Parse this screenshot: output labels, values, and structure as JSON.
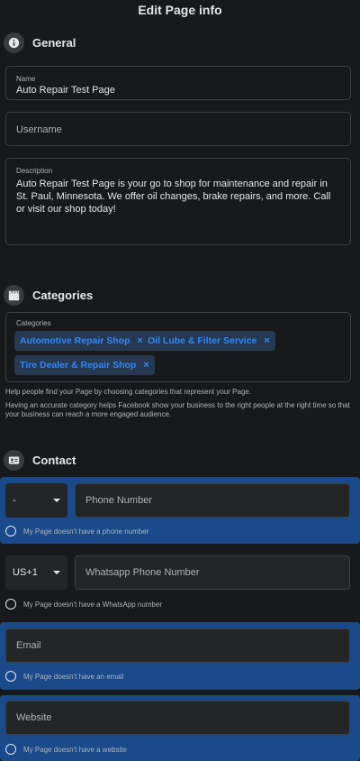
{
  "header": {
    "title": "Edit Page info"
  },
  "general": {
    "heading": "General",
    "icon": "info-icon",
    "name": {
      "label": "Name",
      "value": "Auto Repair Test Page"
    },
    "username": {
      "placeholder": "Username"
    },
    "description": {
      "label": "Description",
      "value": "Auto Repair Test Page is your go to shop for maintenance and repair in St. Paul, Minnesota. We offer oil changes, brake repairs, and more. Call or visit our shop today!"
    }
  },
  "categories": {
    "heading": "Categories",
    "icon": "clapperboard-icon",
    "label": "Categories",
    "chips": [
      "Automotive Repair Shop",
      "Oil Lube & Filter Service",
      "Tire Dealer & Repair Shop"
    ],
    "remove_glyph": "×",
    "help1": "Help people find your Page by choosing categories that represent your Page.",
    "help2": "Having an accurate category helps Facebook show your business to the right people at the right time so that your business can reach a more engaged audience."
  },
  "contact": {
    "heading": "Contact",
    "icon": "contact-card-icon",
    "phone": {
      "country_code": "-",
      "placeholder": "Phone Number",
      "no_option": "My Page doesn't have a phone number"
    },
    "whatsapp": {
      "country_code": "US+1",
      "placeholder": "Whatsapp Phone Number",
      "no_option": "My Page doesn't have a WhatsApp number"
    },
    "email": {
      "placeholder": "Email",
      "no_option": "My Page doesn't have an email"
    },
    "website": {
      "placeholder": "Website",
      "no_option": "My Page doesn't have a website"
    }
  },
  "colors": {
    "background": "#18191a",
    "highlight": "#1a4a8a",
    "chip_bg": "#263951",
    "chip_text": "#2d88ff"
  }
}
